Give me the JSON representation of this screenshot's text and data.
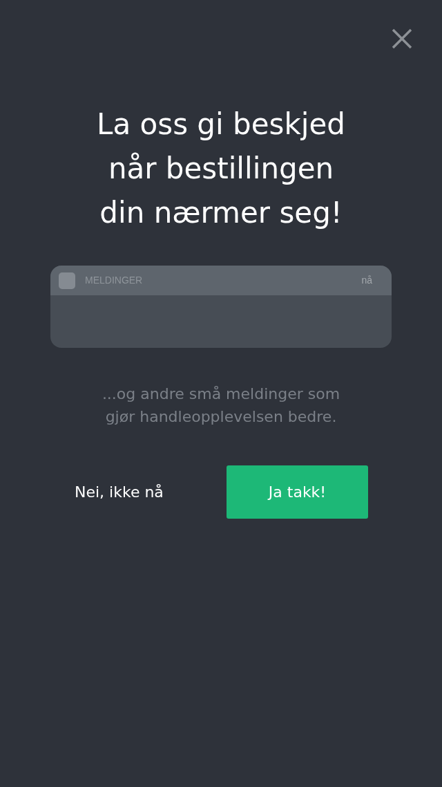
{
  "title_lines": [
    "La oss gi beskjed",
    "når bestillingen",
    "din nærmer seg!"
  ],
  "notification": {
    "app": "MELDINGER",
    "time": "nå"
  },
  "subtitle_lines": [
    "...og andre små meldinger som",
    "gjør handleopplevelsen bedre."
  ],
  "buttons": [
    {
      "label": "Nei, ikke nå",
      "kind": "text"
    },
    {
      "label": "Ja takk!",
      "kind": "primary"
    }
  ]
}
